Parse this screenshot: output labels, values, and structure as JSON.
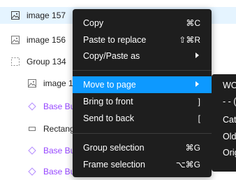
{
  "layers": [
    {
      "name": "image 157",
      "icon": "image-icon",
      "selected": true
    },
    {
      "name": "image 156",
      "icon": "image-icon",
      "selected": false
    },
    {
      "name": "Group 134",
      "icon": "group-icon",
      "selected": false
    },
    {
      "name": "image 1",
      "icon": "image-icon",
      "selected": false
    },
    {
      "name": "Base Bu",
      "icon": "component-icon",
      "selected": false
    },
    {
      "name": "Rectang",
      "icon": "rectangle-icon",
      "selected": false
    },
    {
      "name": "Base Bu",
      "icon": "component-icon",
      "selected": false
    },
    {
      "name": "Base Bu",
      "icon": "component-icon",
      "selected": false
    }
  ],
  "menu": {
    "items": [
      {
        "label": "Copy",
        "shortcut": "⌘C"
      },
      {
        "label": "Paste to replace",
        "shortcut": "⇧⌘R"
      },
      {
        "label": "Copy/Paste as",
        "shortcut": ""
      },
      {
        "label": "Move to page",
        "shortcut": ""
      },
      {
        "label": "Bring to front",
        "shortcut": "]"
      },
      {
        "label": "Send to back",
        "shortcut": "["
      },
      {
        "label": "Group selection",
        "shortcut": "⌘G"
      },
      {
        "label": "Frame selection",
        "shortcut": "⌥⌘G"
      }
    ]
  },
  "submenu": {
    "items": [
      "WO",
      "- - (",
      "Cat",
      "Old",
      "Orig"
    ]
  },
  "colors": {
    "menu_bg": "#1e1e1e",
    "highlight": "#0d99ff",
    "selected_row": "#e5f4ff",
    "component_text": "#9747ff"
  }
}
